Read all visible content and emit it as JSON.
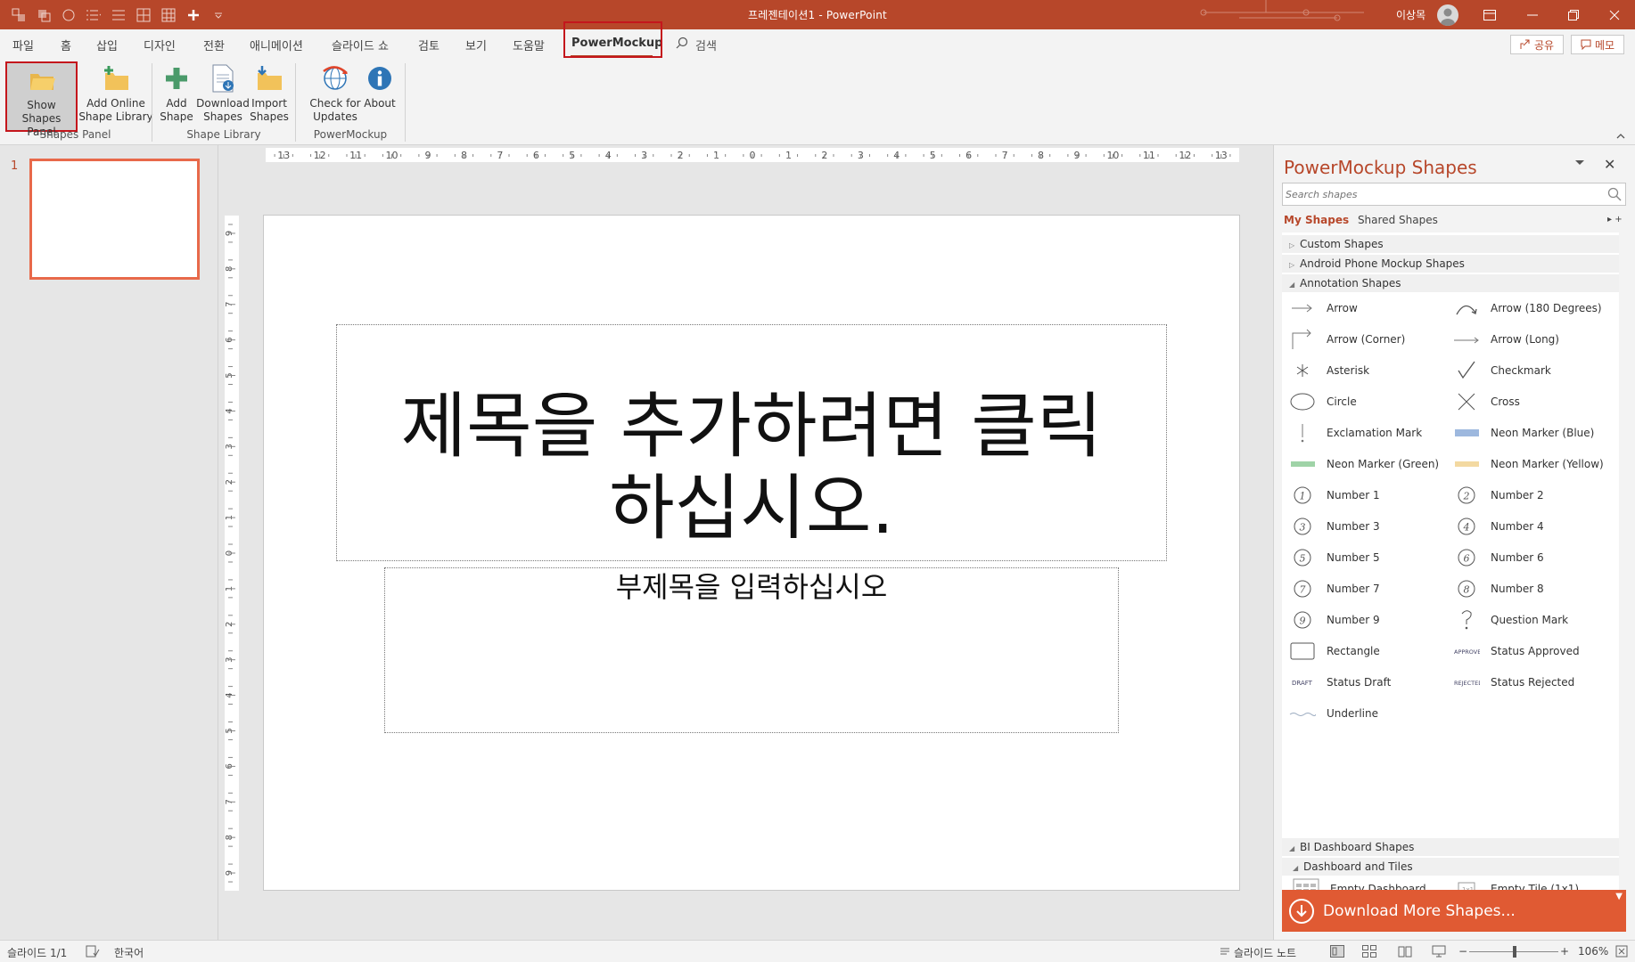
{
  "window": {
    "title": "프레젠테이션1  -  PowerPoint",
    "user_name": "이상목"
  },
  "ribbon_tabs": [
    "파일",
    "홈",
    "삽입",
    "디자인",
    "전환",
    "애니메이션",
    "슬라이드 쇼",
    "검토",
    "보기",
    "도움말",
    "PowerMockup"
  ],
  "active_tab": "PowerMockup",
  "search_label": "검색",
  "share_label": "공유",
  "memo_label": "메모",
  "ribbon": {
    "buttons": [
      {
        "line1": "Show",
        "line2": "Shapes Panel"
      },
      {
        "line1": "Add Online",
        "line2": "Shape Library"
      },
      {
        "line1": "Add",
        "line2": "Shape"
      },
      {
        "line1": "Download",
        "line2": "Shapes"
      },
      {
        "line1": "Import",
        "line2": "Shapes"
      },
      {
        "line1": "Check for",
        "line2": "Updates"
      },
      {
        "line1": "About",
        "line2": ""
      }
    ],
    "groups": [
      "Shapes Panel",
      "Shape Library",
      "PowerMockup"
    ]
  },
  "thumbnails": {
    "slide_number": "1"
  },
  "ruler": {
    "h_ticks": [
      "13",
      "12",
      "11",
      "10",
      "9",
      "8",
      "7",
      "6",
      "5",
      "4",
      "3",
      "2",
      "1",
      "0",
      "1",
      "2",
      "3",
      "4",
      "5",
      "6",
      "7",
      "8",
      "9",
      "10",
      "11",
      "12",
      "13"
    ],
    "v_ticks": [
      "9",
      "8",
      "7",
      "6",
      "5",
      "4",
      "3",
      "2",
      "1",
      "0",
      "1",
      "2",
      "3",
      "4",
      "5",
      "6",
      "7",
      "8",
      "9"
    ]
  },
  "slide": {
    "title_line1": "제목을 추가하려면 클릭",
    "title_line2": "하십시오.",
    "subtitle": "부제목을 입력하십시오"
  },
  "pane": {
    "title": "PowerMockup Shapes",
    "search_placeholder": "Search shapes",
    "tab_my": "My Shapes",
    "tab_shared": "Shared Shapes",
    "categories_top": [
      "Custom Shapes",
      "Android Phone Mockup Shapes",
      "Annotation Shapes"
    ],
    "annotation_shapes": [
      "Arrow",
      "Arrow (180 Degrees)",
      "Arrow (Corner)",
      "Arrow (Long)",
      "Asterisk",
      "Checkmark",
      "Circle",
      "Cross",
      "Exclamation Mark",
      "Neon Marker (Blue)",
      "Neon Marker (Green)",
      "Neon Marker (Yellow)",
      "Number 1",
      "Number 2",
      "Number 3",
      "Number 4",
      "Number 5",
      "Number 6",
      "Number 7",
      "Number 8",
      "Number 9",
      "Question Mark",
      "Rectangle",
      "Status Approved",
      "Status Draft",
      "Status Rejected",
      "Underline"
    ],
    "category_bi": "BI Dashboard Shapes",
    "category_dashboard": "Dashboard and Tiles",
    "dashboard_shapes": [
      "Empty Dashboard",
      "Empty Tile (1x1)"
    ],
    "download_label": "Download More Shapes..."
  },
  "status": {
    "slide_count": "슬라이드 1/1",
    "language": "한국어",
    "notes": "슬라이드 노트",
    "zoom": "106%"
  },
  "colors": {
    "accent": "#b7472a",
    "highlight_box": "#c4161c",
    "download_bar": "#e05a33"
  }
}
